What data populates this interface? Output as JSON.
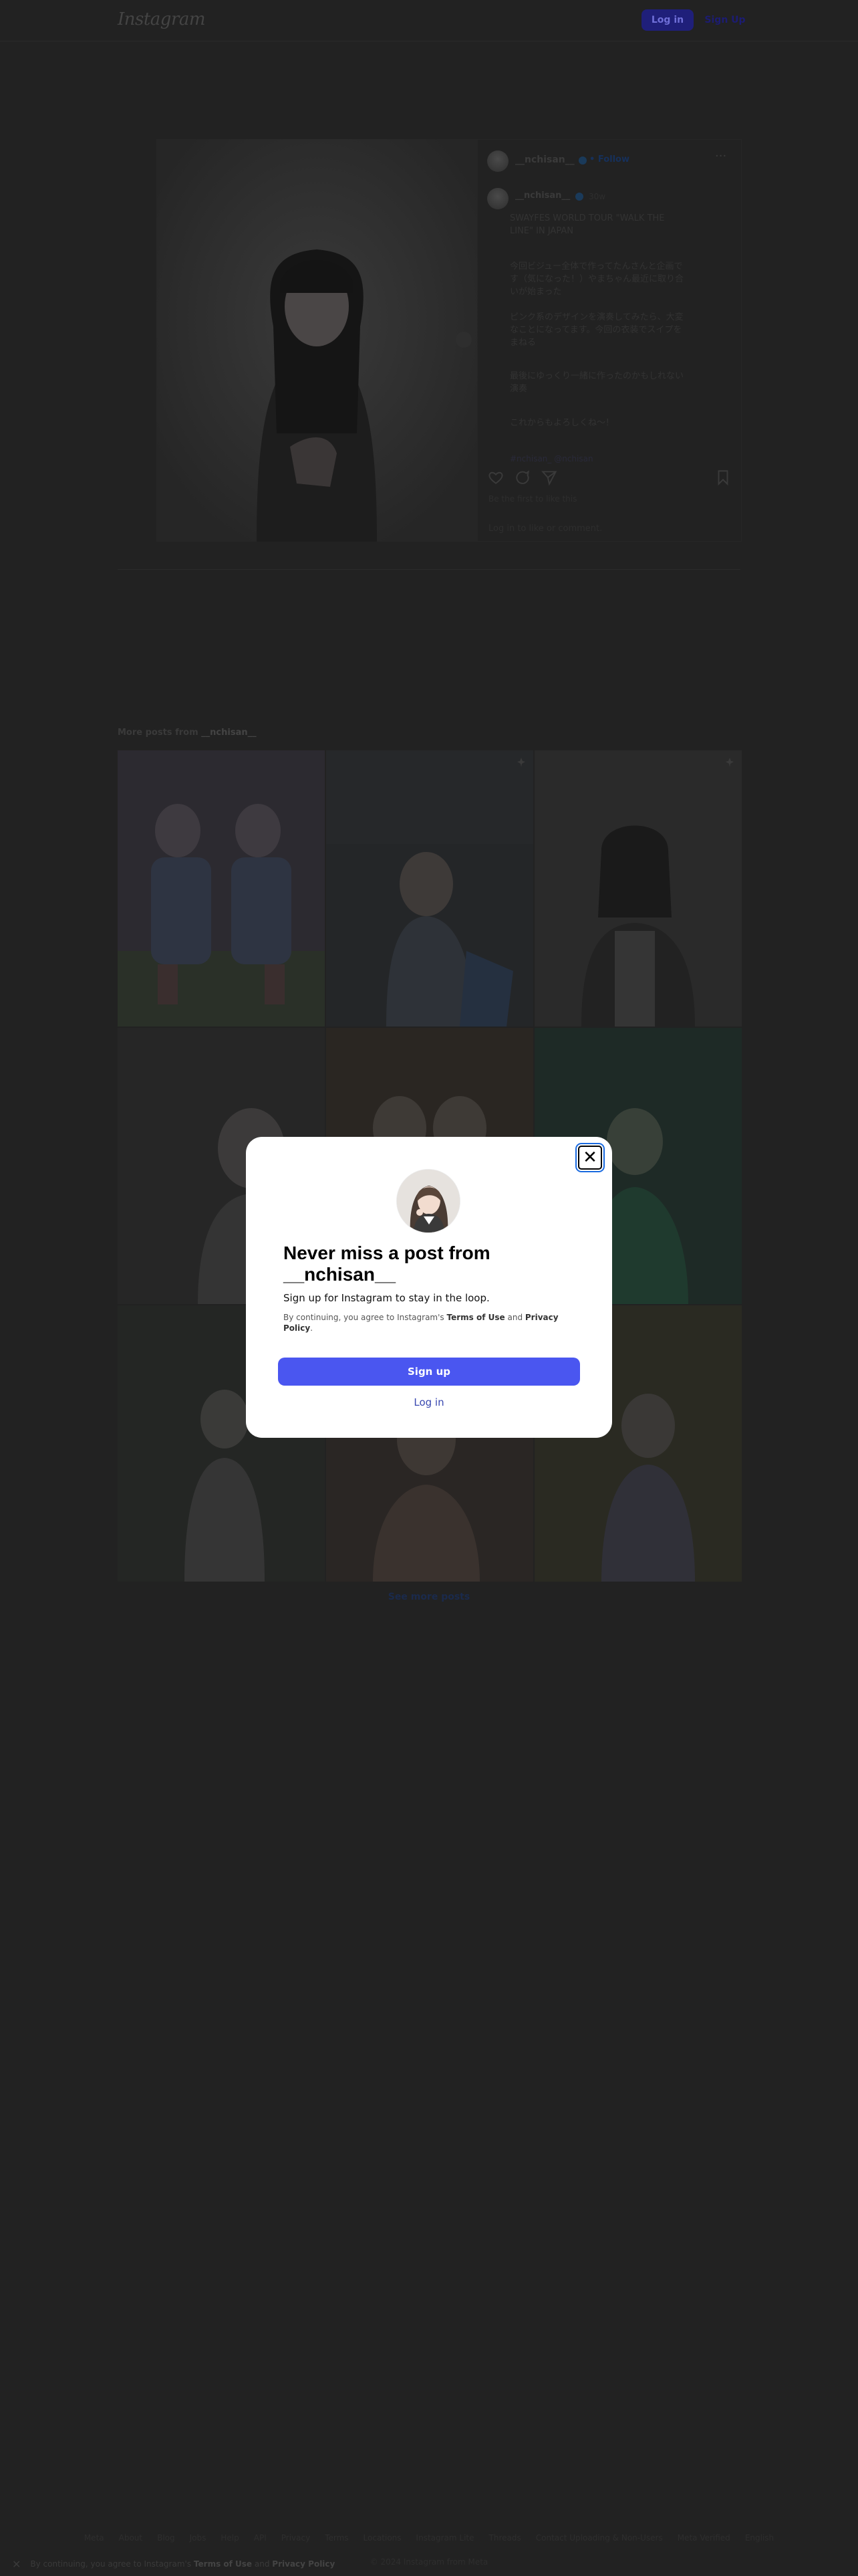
{
  "header": {
    "logo_text": "Instagram",
    "login_label": "Log in",
    "signup_label": "Sign Up"
  },
  "post": {
    "username": "__nchisan__",
    "follow_label": "• Follow",
    "more_icon": "more-horizontal-icon",
    "caption_username": "__nchisan__",
    "caption_time": "30w",
    "caption_lines": [
      "SWAYFES WORLD TOUR \"WALK THE LINE\" IN JAPAN",
      "今回ビジュー全体で作ってたんさんと企画です（気になった！）やまちゃん最近に取り合いが始まった",
      "ピンク系のデザインを演奏してみたら、大変なことになってます。今回の衣装でスイプをまねる",
      "最後にゆっくり一緒に作ったのかもしれない演奏",
      "これからもよろしくね〜！"
    ],
    "caption_footer": "#nchisan_  @nchisan",
    "likes_text": "Be the first to like this",
    "login_comment": "Log in to like or comment."
  },
  "more_posts": {
    "prefix": "More posts from",
    "username": "__nchisan__"
  },
  "see_more_label": "See more posts",
  "footer_links": [
    "Meta",
    "About",
    "Blog",
    "Jobs",
    "Help",
    "API",
    "Privacy",
    "Terms",
    "Locations",
    "Instagram Lite",
    "Threads",
    "Contact Uploading & Non-Users",
    "Meta Verified",
    "English",
    "© 2024 Instagram from Meta"
  ],
  "cookie": {
    "prefix": "By continuing, you agree to Instagram's",
    "terms": "Terms of Use",
    "and": "and",
    "privacy": "Privacy Policy"
  },
  "modal": {
    "title": "Never miss a post from __nchisan__",
    "subtitle": "Sign up for Instagram to stay in the loop.",
    "terms_prefix": "By continuing, you agree to Instagram's",
    "terms_link": "Terms of Use",
    "terms_and": "and",
    "privacy_link": "Privacy Policy",
    "signup_label": "Sign up",
    "login_label": "Log in",
    "close_icon": "close-icon"
  },
  "colors": {
    "page_background": "#222222",
    "modal_background": "#ffffff",
    "primary_button": "#4a56f0",
    "link_blue": "#3847b0"
  }
}
